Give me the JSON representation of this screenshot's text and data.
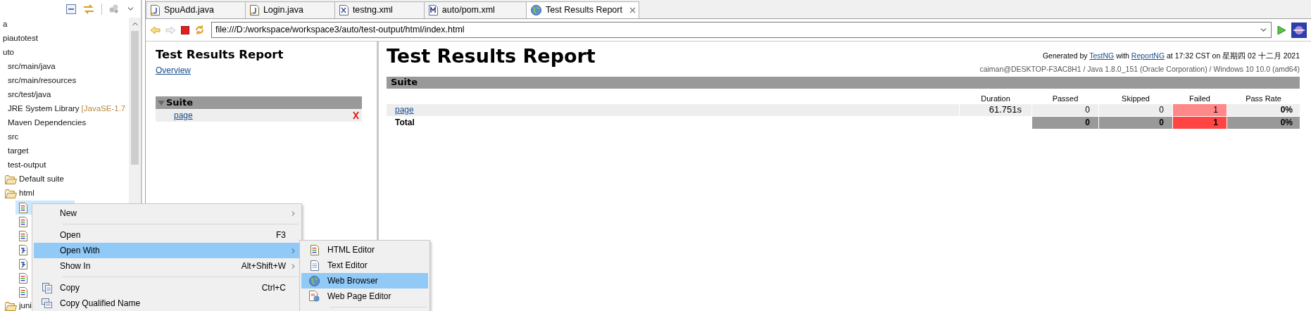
{
  "project_explorer": {
    "tree": [
      {
        "label": "a",
        "selected": false
      },
      {
        "label": "piautotest",
        "selected": false
      },
      {
        "label": "uto",
        "selected": false,
        "children": [
          {
            "label": "src/main/java",
            "selected": false
          },
          {
            "label": "src/main/resources",
            "selected": false
          },
          {
            "label": "src/test/java",
            "selected": false
          },
          {
            "label": "JRE System Library",
            "decoration": "[JavaSE-1.7",
            "selected": false
          },
          {
            "label": "Maven Dependencies",
            "selected": false
          },
          {
            "label": "src",
            "selected": false
          },
          {
            "label": "target",
            "selected": false
          },
          {
            "label": "test-output",
            "selected": false,
            "children": [
              {
                "label": "Default suite",
                "kind": "folder",
                "selected": false
              },
              {
                "label": "html",
                "kind": "folder",
                "selected": false,
                "children": [
                  {
                    "kind": "html-file",
                    "selected": true
                  },
                  {
                    "kind": "html-file",
                    "selected": false
                  },
                  {
                    "kind": "html-file",
                    "selected": false
                  },
                  {
                    "kind": "js-file",
                    "selected": false
                  },
                  {
                    "kind": "js-file",
                    "selected": false
                  },
                  {
                    "kind": "html-file",
                    "selected": false
                  },
                  {
                    "kind": "html-file",
                    "selected": false
                  }
                ]
              },
              {
                "label": "juni",
                "kind": "folder",
                "selected": false
              }
            ]
          }
        ]
      }
    ]
  },
  "editor_tabs": [
    {
      "label": "SpuAdd.java",
      "kind": "java",
      "selected": false
    },
    {
      "label": "Login.java",
      "kind": "java",
      "selected": false
    },
    {
      "label": "testng.xml",
      "kind": "xml",
      "selected": false
    },
    {
      "label": "auto/pom.xml",
      "kind": "maven",
      "selected": false
    },
    {
      "label": "Test Results Report",
      "kind": "browser",
      "selected": true
    }
  ],
  "browser": {
    "url": "file:///D:/workspace/workspace3/auto/test-output/html/index.html"
  },
  "report_nav": {
    "title": "Test Results Report",
    "overview_link": "Overview",
    "suites": [
      {
        "name": "Suite",
        "expanded": true,
        "tests": [
          {
            "name": "page",
            "failed": true
          }
        ]
      }
    ]
  },
  "report": {
    "title": "Test Results Report",
    "generated": {
      "prefix": "Generated by",
      "tool": "TestNG",
      "middle": "with",
      "reporter": "ReportNG",
      "suffix": "at 17:32 CST on 星期四 02 十二月 2021"
    },
    "system_info": "caiman@DESKTOP-F3AC8H1 / Java 1.8.0_151 (Oracle Corporation) / Windows 10 10.0 (amd64)",
    "suite_header": "Suite",
    "columns": [
      "Duration",
      "Passed",
      "Skipped",
      "Failed",
      "Pass Rate"
    ],
    "rows": [
      {
        "kind": "test",
        "name": "page",
        "duration": "61.751s",
        "passed": "0",
        "skipped": "0",
        "failed": "1",
        "pass_rate": "0%"
      },
      {
        "kind": "total",
        "name": "Total",
        "passed": "0",
        "skipped": "0",
        "failed": "1",
        "pass_rate": "0%"
      }
    ]
  },
  "context_menu": {
    "items": [
      {
        "kind": "item",
        "label": "New",
        "submenu": true,
        "selected": false
      },
      {
        "kind": "separator"
      },
      {
        "kind": "item",
        "label": "Open",
        "shortcut": "F3",
        "submenu": false,
        "selected": false
      },
      {
        "kind": "item",
        "label": "Open With",
        "submenu": true,
        "selected": true
      },
      {
        "kind": "item",
        "label": "Show In",
        "shortcut": "Alt+Shift+W",
        "submenu": true,
        "selected": false
      },
      {
        "kind": "separator"
      },
      {
        "kind": "item",
        "label": "Copy",
        "shortcut": "Ctrl+C",
        "submenu": false,
        "selected": false
      },
      {
        "kind": "item",
        "label": "Copy Qualified Name",
        "submenu": false,
        "selected": false
      }
    ],
    "submenu": [
      {
        "kind": "item",
        "label": "HTML Editor",
        "selected": false
      },
      {
        "kind": "item",
        "label": "Text Editor",
        "selected": false
      },
      {
        "kind": "item",
        "label": "Web Browser",
        "selected": true
      },
      {
        "kind": "item",
        "label": "Web Page Editor",
        "selected": false
      },
      {
        "kind": "separator"
      }
    ]
  }
}
